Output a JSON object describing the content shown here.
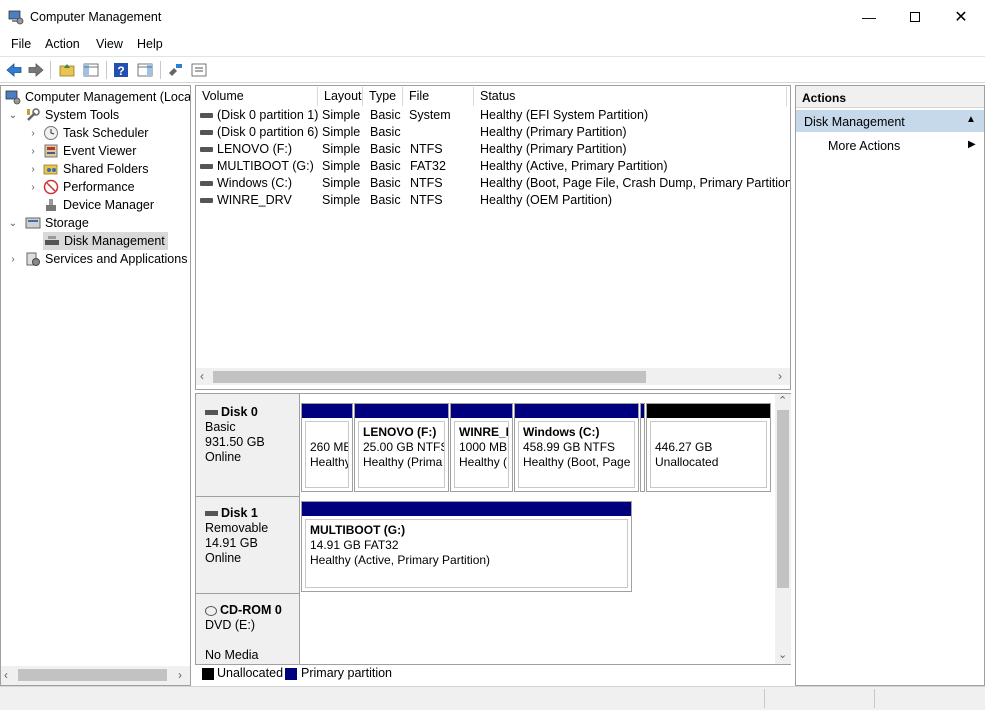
{
  "window": {
    "title": "Computer Management"
  },
  "menu": [
    "File",
    "Action",
    "View",
    "Help"
  ],
  "tree": {
    "root": "Computer Management (Local",
    "system_tools": "System Tools",
    "task_scheduler": "Task Scheduler",
    "event_viewer": "Event Viewer",
    "shared_folders": "Shared Folders",
    "performance": "Performance",
    "device_manager": "Device Manager",
    "storage": "Storage",
    "disk_management": "Disk Management",
    "services": "Services and Applications"
  },
  "list": {
    "columns": [
      "Volume",
      "Layout",
      "Type",
      "File System",
      "Status"
    ],
    "rows": [
      {
        "volume": "(Disk 0 partition 1)",
        "layout": "Simple",
        "type": "Basic",
        "fs": "",
        "status": "Healthy (EFI System Partition)"
      },
      {
        "volume": "(Disk 0 partition 6)",
        "layout": "Simple",
        "type": "Basic",
        "fs": "",
        "status": "Healthy (Primary Partition)"
      },
      {
        "volume": "LENOVO (F:)",
        "layout": "Simple",
        "type": "Basic",
        "fs": "NTFS",
        "status": "Healthy (Primary Partition)"
      },
      {
        "volume": "MULTIBOOT (G:)",
        "layout": "Simple",
        "type": "Basic",
        "fs": "FAT32",
        "status": "Healthy (Active, Primary Partition)"
      },
      {
        "volume": "Windows (C:)",
        "layout": "Simple",
        "type": "Basic",
        "fs": "NTFS",
        "status": "Healthy (Boot, Page File, Crash Dump, Primary Partition)"
      },
      {
        "volume": "WINRE_DRV",
        "layout": "Simple",
        "type": "Basic",
        "fs": "NTFS",
        "status": "Healthy (OEM Partition)"
      }
    ]
  },
  "disks": {
    "disk0": {
      "name": "Disk 0",
      "type": "Basic",
      "size": "931.50 GB",
      "state": "Online",
      "p1": {
        "l1": "260 ME",
        "l2": "Healthy"
      },
      "p2": {
        "name": "LENOVO  (F:)",
        "l1": "25.00 GB NTFS",
        "l2": "Healthy (Prima"
      },
      "p3": {
        "name": "WINRE_D",
        "l1": "1000 MB",
        "l2": "Healthy ("
      },
      "p4": {
        "name": "Windows  (C:)",
        "l1": "458.99 GB NTFS",
        "l2": "Healthy (Boot, Page"
      },
      "p5": {
        "l1": "446.27 GB",
        "l2": "Unallocated"
      }
    },
    "disk1": {
      "name": "Disk 1",
      "type": "Removable",
      "size": "14.91 GB",
      "state": "Online",
      "p1": {
        "name": "MULTIBOOT  (G:)",
        "l1": "14.91 GB FAT32",
        "l2": "Healthy (Active, Primary Partition)"
      }
    },
    "cdrom0": {
      "name": "CD-ROM 0",
      "type": "DVD (E:)",
      "state": "No Media"
    }
  },
  "legend": {
    "unallocated": "Unallocated",
    "primary": "Primary partition"
  },
  "actions": {
    "header": "Actions",
    "section": "Disk Management",
    "more": "More Actions"
  },
  "colors": {
    "primary": "#00007f",
    "unallocated": "#000000",
    "selected_section": "#c5d9ea"
  }
}
